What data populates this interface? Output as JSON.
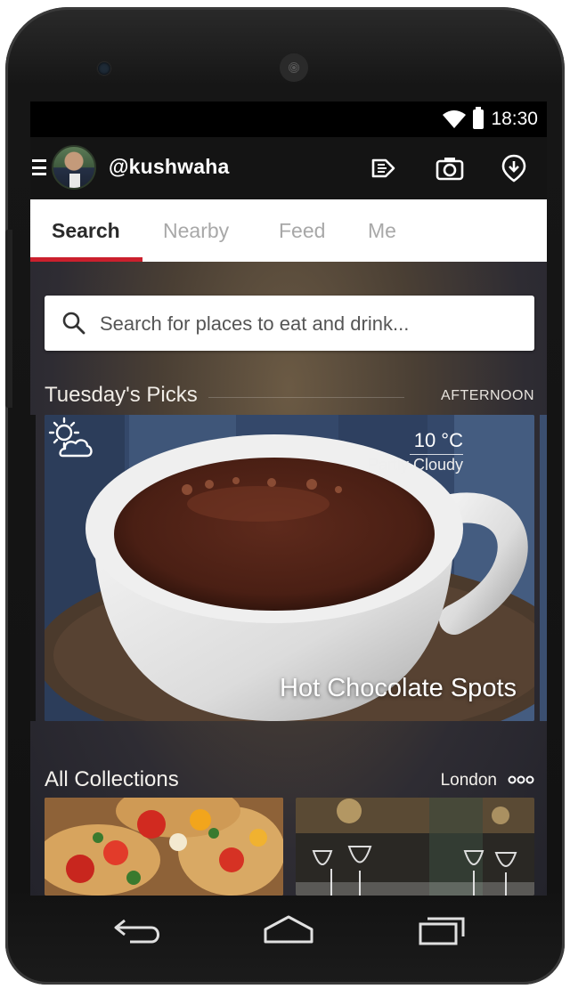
{
  "status_bar": {
    "time": "18:30",
    "wifi_icon": "wifi-icon",
    "battery_icon": "battery-icon"
  },
  "app_bar": {
    "username": "@kushwaha",
    "icons": [
      "menu-icon",
      "checkin-icon",
      "camera-icon",
      "download-icon"
    ]
  },
  "tabs": [
    {
      "label": "Search",
      "active": true
    },
    {
      "label": "Nearby",
      "active": false
    },
    {
      "label": "Feed",
      "active": false
    },
    {
      "label": "Me",
      "active": false
    }
  ],
  "search": {
    "placeholder": "Search for places to eat and drink..."
  },
  "picks": {
    "title": "Tuesday's Picks",
    "time_of_day": "AFTERNOON",
    "card": {
      "temperature": "10 °C",
      "condition": "Partly Cloudy",
      "weather_icon": "partly-cloudy-icon",
      "title": "Hot Chocolate Spots"
    }
  },
  "collections": {
    "title": "All Collections",
    "city": "London",
    "more_icon": "more-dots-icon"
  },
  "colors": {
    "accent": "#cb202d",
    "appbar": "#141414"
  },
  "nav_bar": [
    "back-icon",
    "home-icon",
    "recents-icon"
  ]
}
